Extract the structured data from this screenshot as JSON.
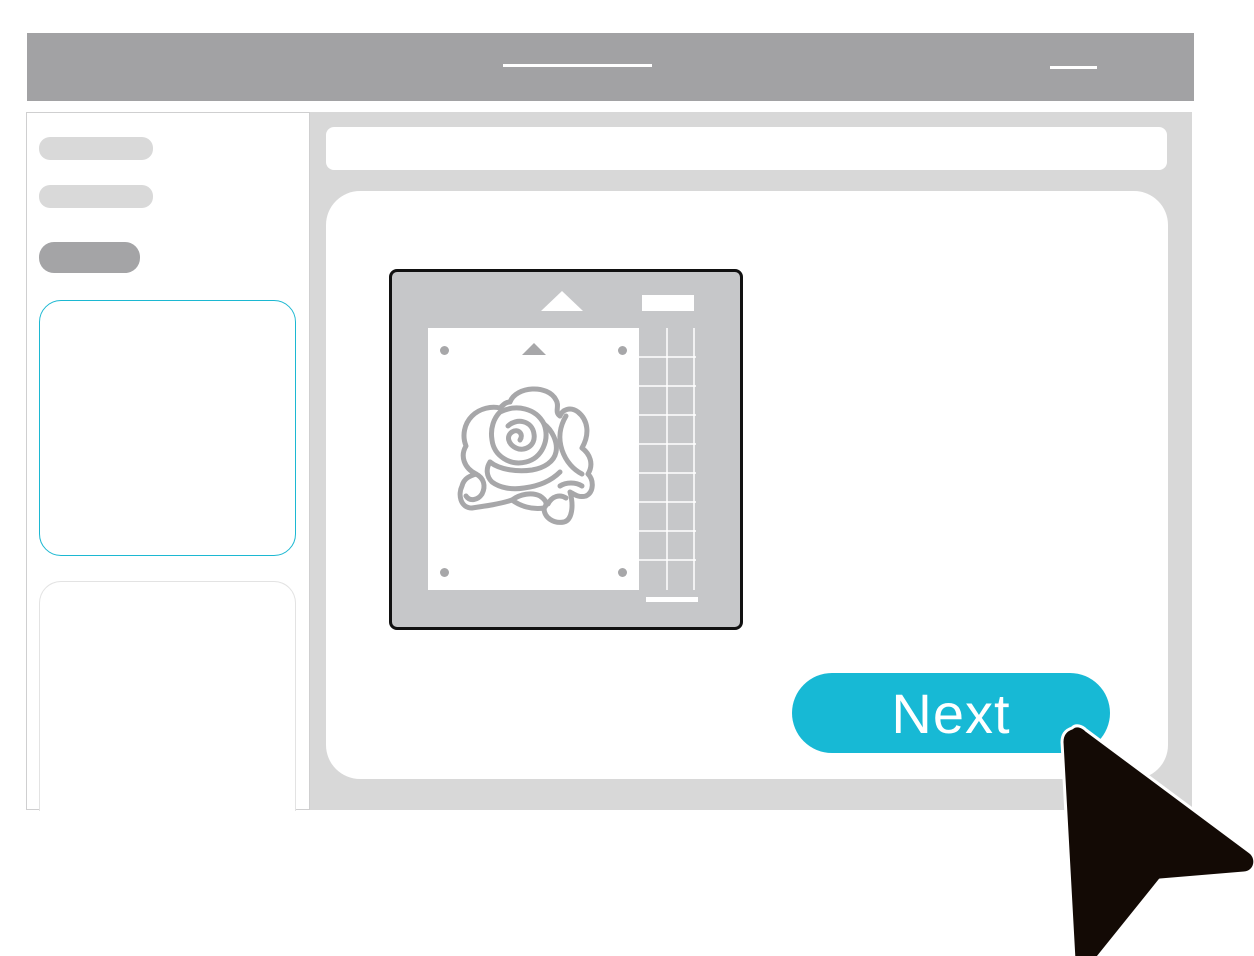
{
  "topbar": {
    "title_placeholder": "",
    "minimize_icon": "minimize-icon"
  },
  "sidebar": {
    "items": [
      {
        "label": "",
        "state": "default"
      },
      {
        "label": "",
        "state": "default"
      },
      {
        "label": "",
        "state": "selected"
      }
    ],
    "cards": [
      {
        "state": "active",
        "border_color": "#1cb8d2"
      },
      {
        "state": "default"
      }
    ]
  },
  "main": {
    "search_placeholder": "",
    "mat_preview": {
      "design_icon": "rose-icon",
      "load_direction_icon": "arrow-up-icon"
    },
    "next_label": "Next"
  },
  "colors": {
    "accent": "#17b9d5",
    "topbar": "#a2a2a4",
    "panel": "#d8d8d8",
    "design": "#a7a7a9"
  },
  "cursor_icon": "pointer-arrow-icon"
}
